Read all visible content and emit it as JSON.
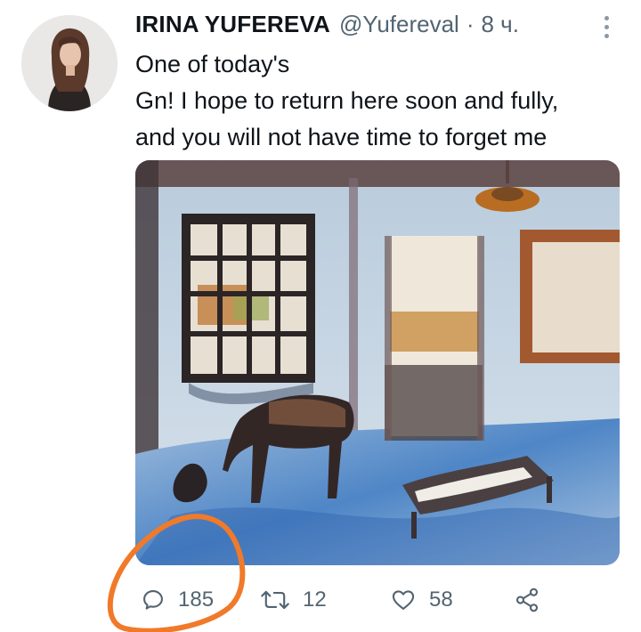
{
  "tweet": {
    "author": {
      "display_name": "IRINA YUFEREVA",
      "handle": "@Yufereval"
    },
    "separator": "·",
    "time": "8 ч.",
    "text_lines": [
      "One of today's",
      "Gn! I hope to return here soon and fully,",
      "and you will not have time to forget me"
    ],
    "stats": {
      "replies": "185",
      "retweets": "12",
      "likes": "58"
    }
  },
  "colors": {
    "text": "#0f1419",
    "secondary": "#536471",
    "annotation": "#f07a2a"
  },
  "icons": {
    "more": "more-vertical-icon",
    "reply": "reply-icon",
    "retweet": "retweet-icon",
    "like": "heart-icon",
    "share": "share-icon"
  }
}
